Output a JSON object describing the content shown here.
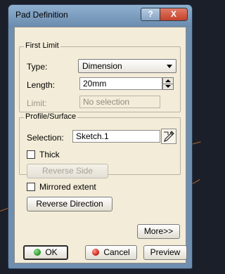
{
  "window": {
    "title": "Pad Definition",
    "help_label": "?",
    "close_label": "X"
  },
  "first_limit": {
    "legend": "First Limit",
    "type_label": "Type:",
    "type_value": "Dimension",
    "length_label": "Length:",
    "length_value": "20mm",
    "limit_label": "Limit:",
    "limit_value": "No selection"
  },
  "profile": {
    "legend": "Profile/Surface",
    "selection_label": "Selection:",
    "selection_value": "Sketch.1",
    "thick_label": "Thick",
    "reverse_side_label": "Reverse Side"
  },
  "mirrored_label": "Mirrored extent",
  "reverse_direction_label": "Reverse Direction",
  "more_label": "More>>",
  "footer": {
    "ok_label": "OK",
    "cancel_label": "Cancel",
    "preview_label": "Preview"
  },
  "colors": {
    "ok_dot": "#2fa12f",
    "cancel_dot": "#d42a1e"
  }
}
